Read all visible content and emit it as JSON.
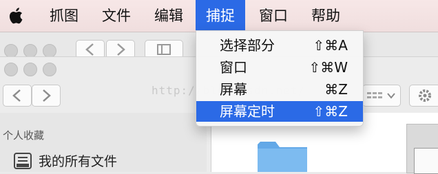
{
  "menubar": {
    "items": [
      "抓图",
      "文件",
      "编辑",
      "捕捉",
      "窗口",
      "帮助"
    ],
    "active_index": 3
  },
  "capture_menu": {
    "items": [
      {
        "label": "选择部分",
        "shortcut": "⇧⌘A"
      },
      {
        "label": "窗口",
        "shortcut": "⇧⌘W"
      },
      {
        "label": "屏幕",
        "shortcut": "⌘Z"
      },
      {
        "label": "屏幕定时",
        "shortcut": "⇧⌘Z"
      }
    ],
    "highlighted_index": 3
  },
  "sidebar": {
    "heading": "个人收藏",
    "items": [
      {
        "label": "我的所有文件",
        "icon": "all-files-icon"
      }
    ]
  },
  "watermark": "http://blog.csdn.net/",
  "colors": {
    "accent": "#2b6ae6",
    "menubar_bg": "#f4e4e4"
  }
}
